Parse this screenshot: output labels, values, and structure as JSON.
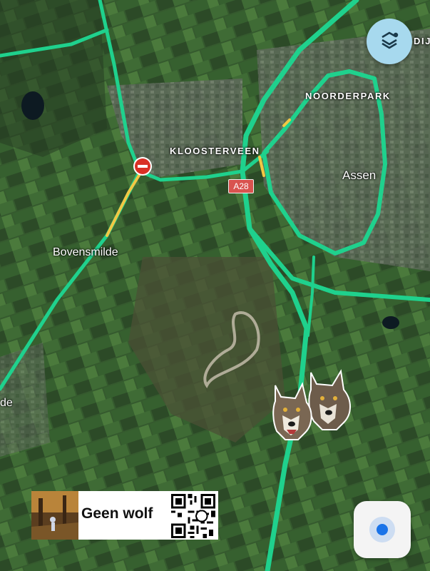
{
  "map": {
    "place_labels": {
      "noorderpark": "NOORDERPARK",
      "kloosterveen": "KLOOSTERVEEN",
      "assen": "Assen",
      "bovensmilde": "Bovensmilde",
      "de_edge": "de",
      "dij_edge": "DIJ"
    },
    "road_shield": "A28",
    "traffic_colors": {
      "free_flow": "#1fd18d",
      "slow": "#f2c744",
      "road_closed": "#d93025"
    }
  },
  "controls": {
    "layers_icon": "layers-icon",
    "location_icon": "my-location-icon"
  },
  "overlay": {
    "banner_text": "Geen wolf",
    "qr_icon": "qr-code-icon",
    "sticker_icon": "wolf-heads-icon"
  }
}
